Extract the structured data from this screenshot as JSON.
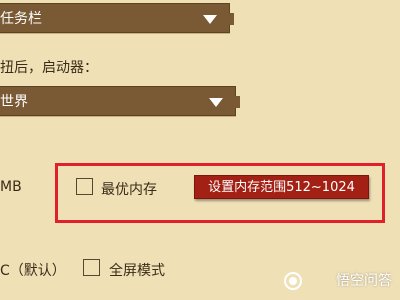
{
  "dropdown_taskbar": {
    "value": "任务栏"
  },
  "launcher_label": "扭后，启动器：",
  "dropdown_world": {
    "value": "世界"
  },
  "memory_unit": "MB",
  "optimal_memory": {
    "label": "最优内存",
    "checked": false
  },
  "memory_hint": "设置内存范围512~1024",
  "display_default": "C（默认）",
  "fullscreen": {
    "label": "全屏模式",
    "checked": false
  },
  "watermark": "悟空问答",
  "colors": {
    "background": "#efe0b6",
    "dropdown": "#7a5a34",
    "highlight": "#e0202a",
    "tag": "#a32014"
  },
  "icons": [
    "chevron-down-icon",
    "chevron-down-icon",
    "wukong-logo-icon"
  ]
}
